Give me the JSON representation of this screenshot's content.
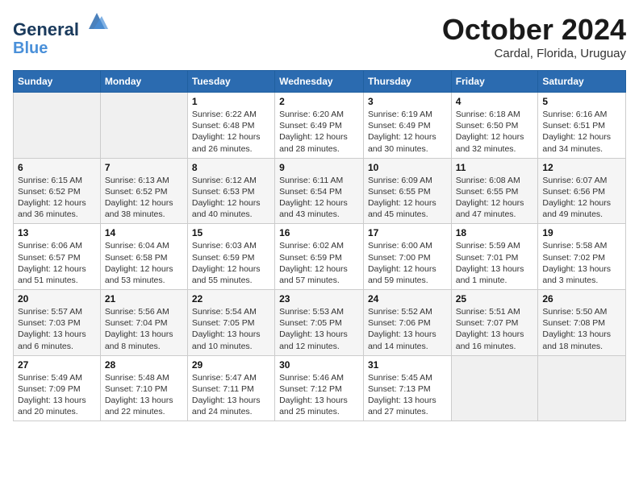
{
  "header": {
    "logo_line1": "General",
    "logo_line2": "Blue",
    "month": "October 2024",
    "location": "Cardal, Florida, Uruguay"
  },
  "days_of_week": [
    "Sunday",
    "Monday",
    "Tuesday",
    "Wednesday",
    "Thursday",
    "Friday",
    "Saturday"
  ],
  "weeks": [
    [
      {
        "num": "",
        "detail": ""
      },
      {
        "num": "",
        "detail": ""
      },
      {
        "num": "1",
        "detail": "Sunrise: 6:22 AM\nSunset: 6:48 PM\nDaylight: 12 hours\nand 26 minutes."
      },
      {
        "num": "2",
        "detail": "Sunrise: 6:20 AM\nSunset: 6:49 PM\nDaylight: 12 hours\nand 28 minutes."
      },
      {
        "num": "3",
        "detail": "Sunrise: 6:19 AM\nSunset: 6:49 PM\nDaylight: 12 hours\nand 30 minutes."
      },
      {
        "num": "4",
        "detail": "Sunrise: 6:18 AM\nSunset: 6:50 PM\nDaylight: 12 hours\nand 32 minutes."
      },
      {
        "num": "5",
        "detail": "Sunrise: 6:16 AM\nSunset: 6:51 PM\nDaylight: 12 hours\nand 34 minutes."
      }
    ],
    [
      {
        "num": "6",
        "detail": "Sunrise: 6:15 AM\nSunset: 6:52 PM\nDaylight: 12 hours\nand 36 minutes."
      },
      {
        "num": "7",
        "detail": "Sunrise: 6:13 AM\nSunset: 6:52 PM\nDaylight: 12 hours\nand 38 minutes."
      },
      {
        "num": "8",
        "detail": "Sunrise: 6:12 AM\nSunset: 6:53 PM\nDaylight: 12 hours\nand 40 minutes."
      },
      {
        "num": "9",
        "detail": "Sunrise: 6:11 AM\nSunset: 6:54 PM\nDaylight: 12 hours\nand 43 minutes."
      },
      {
        "num": "10",
        "detail": "Sunrise: 6:09 AM\nSunset: 6:55 PM\nDaylight: 12 hours\nand 45 minutes."
      },
      {
        "num": "11",
        "detail": "Sunrise: 6:08 AM\nSunset: 6:55 PM\nDaylight: 12 hours\nand 47 minutes."
      },
      {
        "num": "12",
        "detail": "Sunrise: 6:07 AM\nSunset: 6:56 PM\nDaylight: 12 hours\nand 49 minutes."
      }
    ],
    [
      {
        "num": "13",
        "detail": "Sunrise: 6:06 AM\nSunset: 6:57 PM\nDaylight: 12 hours\nand 51 minutes."
      },
      {
        "num": "14",
        "detail": "Sunrise: 6:04 AM\nSunset: 6:58 PM\nDaylight: 12 hours\nand 53 minutes."
      },
      {
        "num": "15",
        "detail": "Sunrise: 6:03 AM\nSunset: 6:59 PM\nDaylight: 12 hours\nand 55 minutes."
      },
      {
        "num": "16",
        "detail": "Sunrise: 6:02 AM\nSunset: 6:59 PM\nDaylight: 12 hours\nand 57 minutes."
      },
      {
        "num": "17",
        "detail": "Sunrise: 6:00 AM\nSunset: 7:00 PM\nDaylight: 12 hours\nand 59 minutes."
      },
      {
        "num": "18",
        "detail": "Sunrise: 5:59 AM\nSunset: 7:01 PM\nDaylight: 13 hours\nand 1 minute."
      },
      {
        "num": "19",
        "detail": "Sunrise: 5:58 AM\nSunset: 7:02 PM\nDaylight: 13 hours\nand 3 minutes."
      }
    ],
    [
      {
        "num": "20",
        "detail": "Sunrise: 5:57 AM\nSunset: 7:03 PM\nDaylight: 13 hours\nand 6 minutes."
      },
      {
        "num": "21",
        "detail": "Sunrise: 5:56 AM\nSunset: 7:04 PM\nDaylight: 13 hours\nand 8 minutes."
      },
      {
        "num": "22",
        "detail": "Sunrise: 5:54 AM\nSunset: 7:05 PM\nDaylight: 13 hours\nand 10 minutes."
      },
      {
        "num": "23",
        "detail": "Sunrise: 5:53 AM\nSunset: 7:05 PM\nDaylight: 13 hours\nand 12 minutes."
      },
      {
        "num": "24",
        "detail": "Sunrise: 5:52 AM\nSunset: 7:06 PM\nDaylight: 13 hours\nand 14 minutes."
      },
      {
        "num": "25",
        "detail": "Sunrise: 5:51 AM\nSunset: 7:07 PM\nDaylight: 13 hours\nand 16 minutes."
      },
      {
        "num": "26",
        "detail": "Sunrise: 5:50 AM\nSunset: 7:08 PM\nDaylight: 13 hours\nand 18 minutes."
      }
    ],
    [
      {
        "num": "27",
        "detail": "Sunrise: 5:49 AM\nSunset: 7:09 PM\nDaylight: 13 hours\nand 20 minutes."
      },
      {
        "num": "28",
        "detail": "Sunrise: 5:48 AM\nSunset: 7:10 PM\nDaylight: 13 hours\nand 22 minutes."
      },
      {
        "num": "29",
        "detail": "Sunrise: 5:47 AM\nSunset: 7:11 PM\nDaylight: 13 hours\nand 24 minutes."
      },
      {
        "num": "30",
        "detail": "Sunrise: 5:46 AM\nSunset: 7:12 PM\nDaylight: 13 hours\nand 25 minutes."
      },
      {
        "num": "31",
        "detail": "Sunrise: 5:45 AM\nSunset: 7:13 PM\nDaylight: 13 hours\nand 27 minutes."
      },
      {
        "num": "",
        "detail": ""
      },
      {
        "num": "",
        "detail": ""
      }
    ]
  ]
}
